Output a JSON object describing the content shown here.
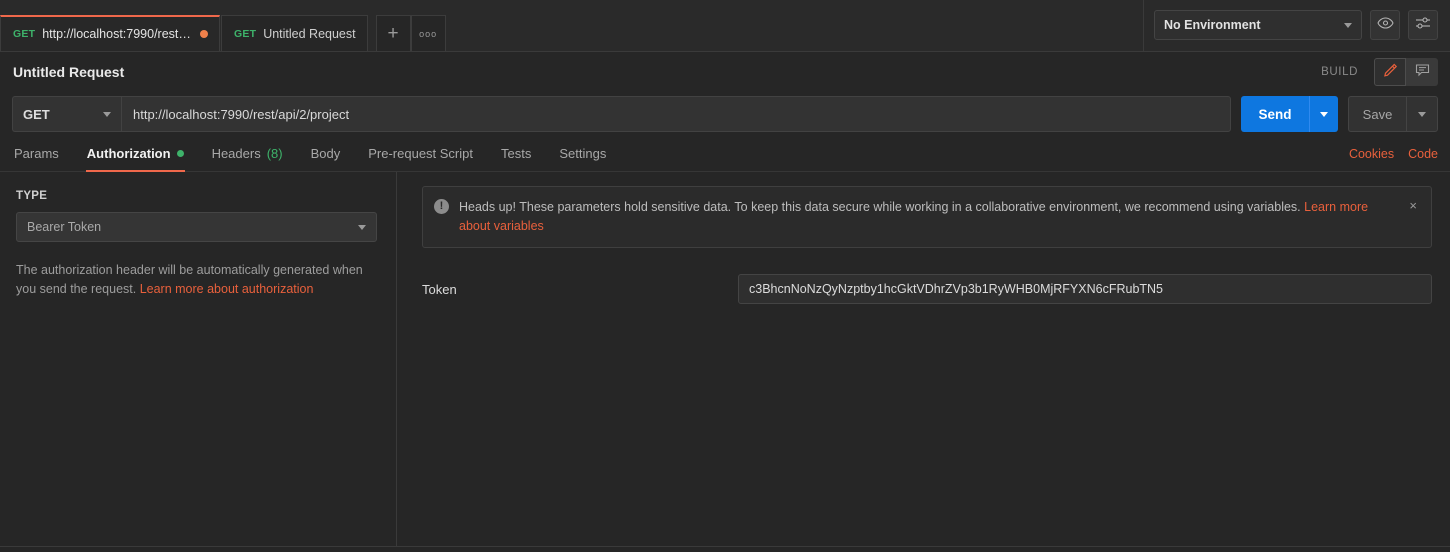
{
  "tabstrip": {
    "tabs": [
      {
        "method": "GET",
        "name": "http://localhost:7990/rest/api/2...",
        "unsaved": true,
        "active": true
      },
      {
        "method": "GET",
        "name": "Untitled Request",
        "unsaved": false,
        "active": false
      }
    ],
    "new_tab_label": "+",
    "more_label": "ooo",
    "environment": {
      "selected": "No Environment",
      "eye_icon": "eye-icon",
      "settings_icon": "sliders-icon"
    }
  },
  "header": {
    "title": "Untitled Request",
    "build_label": "BUILD",
    "edit_icon": "pencil-icon",
    "comment_icon": "comment-icon"
  },
  "request": {
    "method": "GET",
    "url": "http://localhost:7990/rest/api/2/project",
    "send_label": "Send",
    "save_label": "Save"
  },
  "subtabs": {
    "items": [
      {
        "label": "Params",
        "active": false,
        "dot": false,
        "count": ""
      },
      {
        "label": "Authorization",
        "active": true,
        "dot": true,
        "count": ""
      },
      {
        "label": "Headers",
        "active": false,
        "dot": false,
        "count": "(8)"
      },
      {
        "label": "Body",
        "active": false,
        "dot": false,
        "count": ""
      },
      {
        "label": "Pre-request Script",
        "active": false,
        "dot": false,
        "count": ""
      },
      {
        "label": "Tests",
        "active": false,
        "dot": false,
        "count": ""
      },
      {
        "label": "Settings",
        "active": false,
        "dot": false,
        "count": ""
      }
    ],
    "cookies_label": "Cookies",
    "code_label": "Code"
  },
  "auth": {
    "type_heading": "TYPE",
    "type_value": "Bearer Token",
    "help_text": "The authorization header will be automatically generated when you send the request. ",
    "help_link": "Learn more about authorization",
    "notice": {
      "icon": "warning-icon",
      "text": "Heads up! These parameters hold sensitive data. To keep this data secure while working in a collaborative environment, we recommend using variables. ",
      "link": "Learn more about variables",
      "close_label": "×"
    },
    "token_label": "Token",
    "token_value": "c3BhcnNoNzQyNzptby1hcGktVDhrZVp3b1RyWHB0MjRFYXN6cFRubTN5",
    "token_placeholder": "Token"
  },
  "colors": {
    "accent_orange": "#f0684b",
    "send_blue": "#0e77e0",
    "method_green": "#3eb26a",
    "background": "#262626"
  }
}
